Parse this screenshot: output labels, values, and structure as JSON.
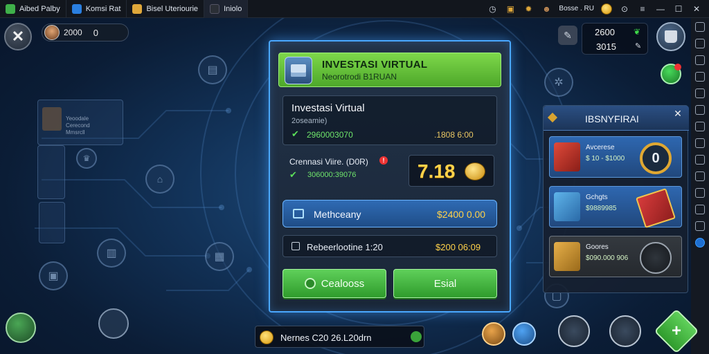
{
  "topbar": {
    "tabs": [
      {
        "label": "Aibed Palby",
        "color": "#3fb04a"
      },
      {
        "label": "Komsi Rat",
        "color": "#2a7fe0"
      },
      {
        "label": "Bisel Uteriourie",
        "color": "#e0a83a"
      },
      {
        "label": "Iniolo",
        "color": "#2b2f36"
      }
    ],
    "account": "Bosse . RU",
    "icons": [
      "history-icon",
      "coin-bag-icon",
      "settings-gear-icon",
      "avatar-icon",
      "coin-icon",
      "minimize-icon",
      "menu-icon",
      "window-minimize-icon",
      "window-maximize-icon",
      "window-close-icon"
    ]
  },
  "hud": {
    "player_amount": "2000",
    "player_count": "0",
    "stat_top": "2600",
    "stat_bottom": "3015"
  },
  "dialog": {
    "title": "INVESTASI VIRTUAL",
    "subtitle": "Neorotrodi B1RUAN",
    "card": {
      "title": "Investasi Virtual",
      "subtitle": "2oseamie)",
      "value_left": "2960003070",
      "value_right": ".1808 6:00"
    },
    "row2": {
      "label": "Crennasi Viire. (D0R)",
      "alert": "!",
      "value": "306000:39076"
    },
    "big_number": "7.18",
    "select_row": {
      "label": "Methceany",
      "value": "$2400 0.00"
    },
    "plain_row": {
      "label": "Rebeerlootine 1:20",
      "value": "$200 06:09"
    },
    "buttons": {
      "left": "Cealooss",
      "right": "Esial"
    }
  },
  "side_panel": {
    "title": "IBSNYFIRAI",
    "close": "✕",
    "items": [
      {
        "name": "Avcerese",
        "price": "$ 10 - $1000",
        "badge": "0"
      },
      {
        "name": "Gchgts",
        "price": "$9889985",
        "badge": ""
      },
      {
        "name": "Goores",
        "price": "$090.000 906",
        "badge": ""
      }
    ]
  },
  "bottom": {
    "pill_text": "Nernes C20 26.L20drn"
  },
  "left_ghost": {
    "panel_text": "Yeoodale Cerecond Mmsrcll"
  },
  "colors": {
    "accent_blue": "#4aa8ff",
    "accent_green": "#5fd05a",
    "gold": "#ffd24a",
    "background": "#123258"
  }
}
